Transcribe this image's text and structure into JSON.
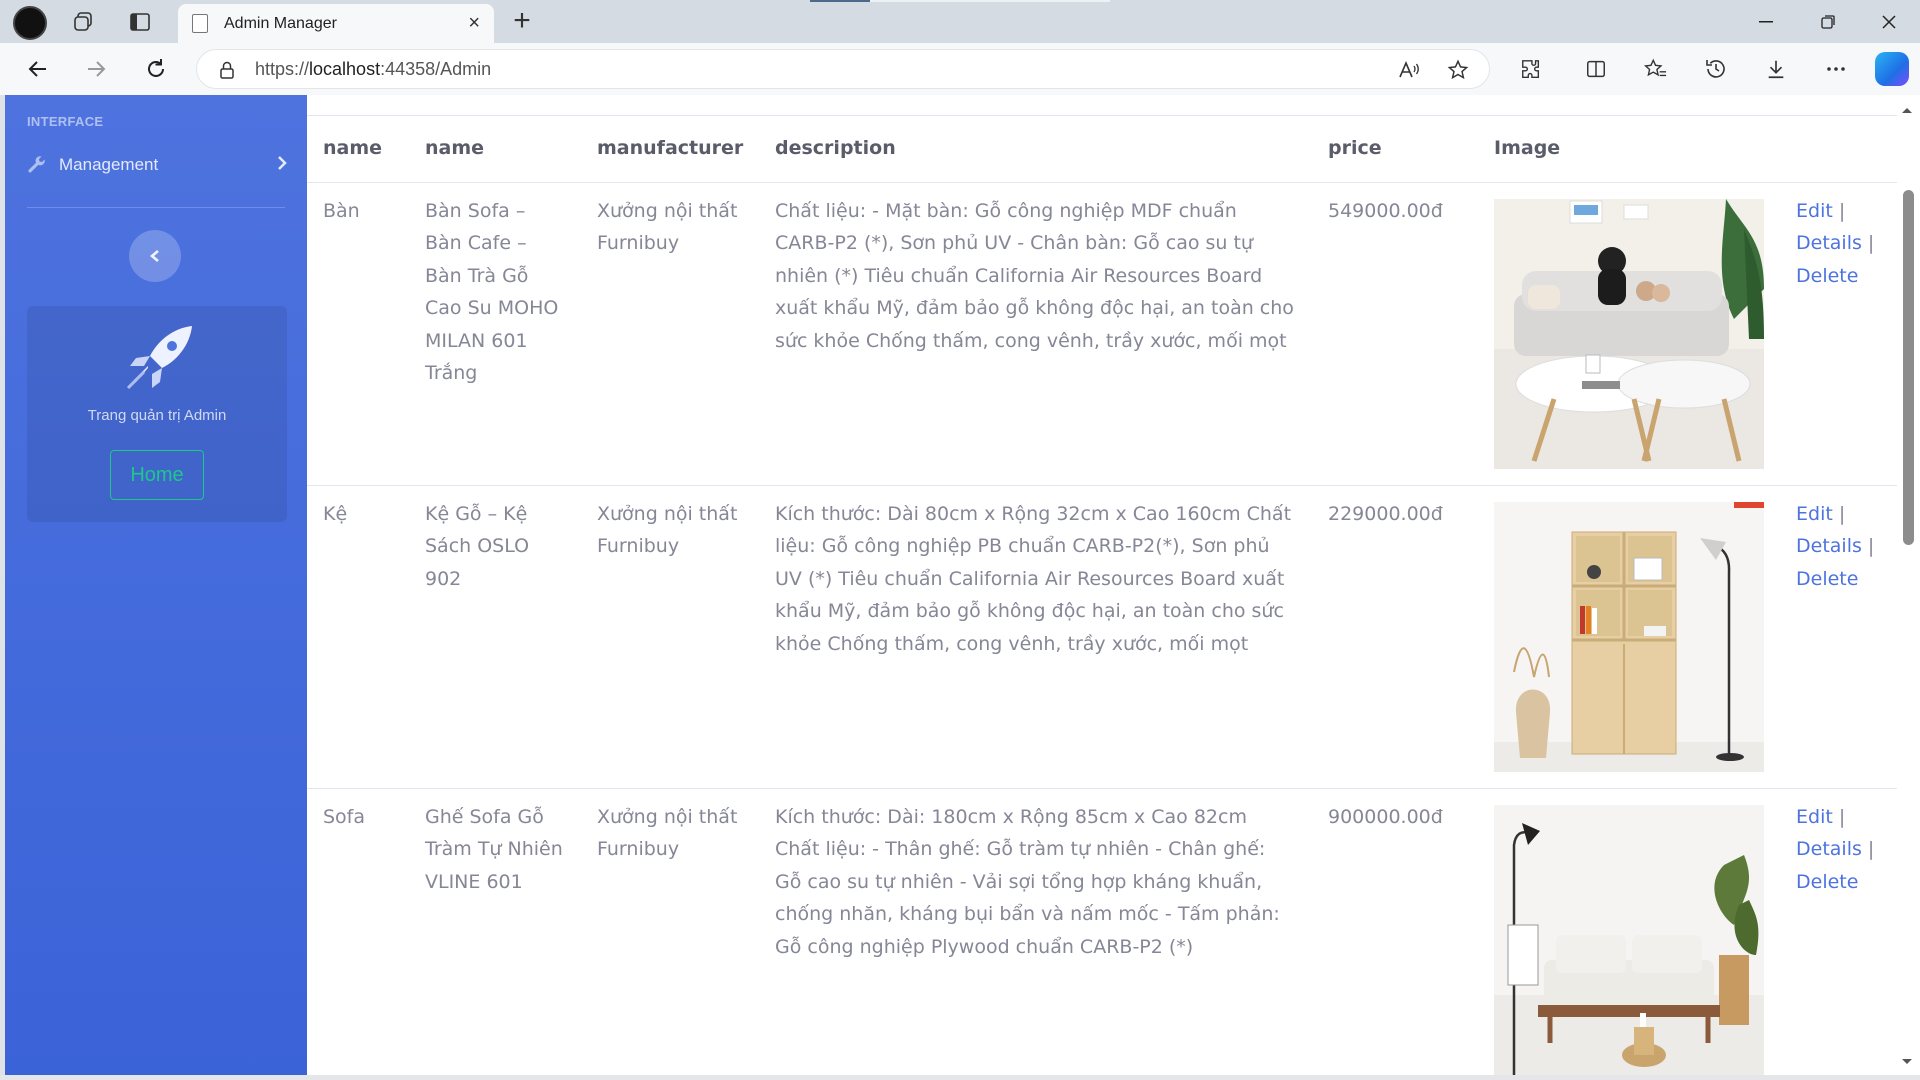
{
  "browser": {
    "tab_title": "Admin Manager",
    "url_prefix": "https://",
    "url_host": "localhost",
    "url_rest": ":44358/Admin",
    "close_glyph": "×",
    "newtab_glyph": "+"
  },
  "sidebar": {
    "heading": "INTERFACE",
    "menu_item": "Management",
    "card_text": "Trang quản trị Admin",
    "home_label": "Home"
  },
  "table": {
    "headers": [
      "name",
      "name",
      "manufacturer",
      "description",
      "price",
      "Image"
    ],
    "rows": [
      {
        "category": "Bàn",
        "name": "Bàn Sofa – Bàn Cafe – Bàn Trà Gỗ Cao Su MOHO MILAN 601 Trắng",
        "manufacturer": "Xưởng nội thất Furnibuy",
        "description": "Chất liệu: - Mặt bàn: Gỗ công nghiệp MDF chuẩn CARB-P2 (*), Sơn phủ UV - Chân bàn: Gỗ cao su tự nhiên (*) Tiêu chuẩn California Air Resources Board xuất khẩu Mỹ, đảm bảo gỗ không độc hại, an toàn cho sức khỏe Chống thấm, cong vênh, trầy xước, mối mọt",
        "price": "549000.00đ",
        "image_icon": "coffee-table-photo"
      },
      {
        "category": "Kệ",
        "name": "Kệ Gỗ – Kệ Sách OSLO 902",
        "manufacturer": "Xưởng nội thất Furnibuy",
        "description": "Kích thước: Dài 80cm x Rộng 32cm x Cao 160cm Chất liệu: Gỗ công nghiệp PB chuẩn CARB-P2(*), Sơn phủ UV (*) Tiêu chuẩn California Air Resources Board xuất khẩu Mỹ, đảm bảo gỗ không độc hại, an toàn cho sức khỏe Chống thấm, cong vênh, trầy xước, mối mọt",
        "price": "229000.00đ",
        "image_icon": "bookshelf-photo"
      },
      {
        "category": "Sofa",
        "name": "Ghế Sofa Gỗ Tràm Tự Nhiên VLINE 601",
        "manufacturer": "Xưởng nội thất Furnibuy",
        "description": "Kích thước: Dài: 180cm x Rộng 85cm x Cao 82cm Chất liệu: - Thân ghế: Gỗ tràm tự nhiên - Chân ghế: Gỗ cao su tự nhiên - Vải sợi tổng hợp kháng khuẩn, chống nhăn, kháng bụi bẩn và nấm mốc - Tấm phản: Gỗ công nghiệp Plywood chuẩn CARB-P2 (*)",
        "price": "900000.00đ",
        "image_icon": "sofa-photo"
      }
    ],
    "actions": {
      "edit": "Edit",
      "details": "Details",
      "delete": "Delete",
      "sep": "|"
    }
  },
  "colors": {
    "sidebar": "#4e73df",
    "link": "#4e73df",
    "home_button": "#1cc88a"
  }
}
